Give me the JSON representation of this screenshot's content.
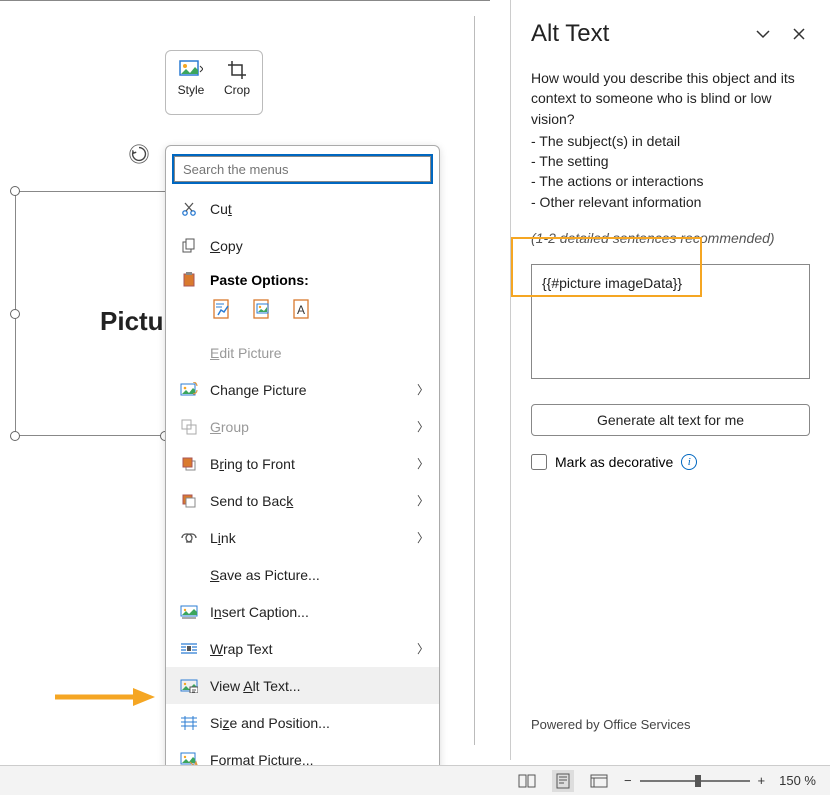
{
  "mini_toolbar": {
    "style": "Style",
    "crop": "Crop"
  },
  "context_menu": {
    "search_placeholder": "Search the menus",
    "cut": "Cut",
    "copy": "Copy",
    "paste_options": "Paste Options:",
    "edit_picture": "Edit Picture",
    "change_picture": "Change Picture",
    "group": "Group",
    "bring_to_front": "Bring to Front",
    "send_to_back": "Send to Back",
    "link": "Link",
    "save_as_picture": "Save as Picture...",
    "insert_caption": "Insert Caption...",
    "wrap_text": "Wrap Text",
    "view_alt_text": "View Alt Text...",
    "size_and_position": "Size and Position...",
    "format_picture": "Format Picture..."
  },
  "picture_placeholder_label": "Pictu",
  "alt_text_panel": {
    "title": "Alt Text",
    "description": "How would you describe this object and its context to someone who is blind or low vision?",
    "bullets": [
      "- The subject(s) in detail",
      "- The setting",
      "- The actions or interactions",
      "- Other relevant information"
    ],
    "hint": "(1-2 detailed sentences recommended)",
    "textbox_value": "{{#picture imageData}}",
    "generate_button": "Generate alt text for me",
    "mark_decorative": "Mark as decorative",
    "powered_by": "Powered by Office Services"
  },
  "status_bar": {
    "zoom": "150 %"
  }
}
